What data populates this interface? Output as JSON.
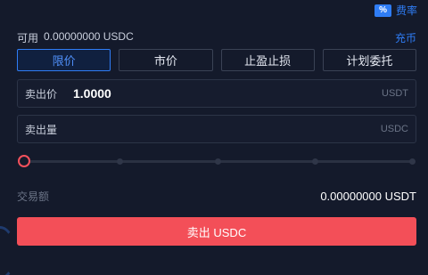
{
  "fee": {
    "badge": "%",
    "label": "费率"
  },
  "balance": {
    "label": "可用",
    "value": "0.00000000 USDC",
    "recharge": "充币"
  },
  "tabs": [
    {
      "label": "限价",
      "active": true
    },
    {
      "label": "市价",
      "active": false
    },
    {
      "label": "止盈止损",
      "active": false
    },
    {
      "label": "计划委托",
      "active": false
    }
  ],
  "price_field": {
    "label": "卖出价",
    "value": "1.0000",
    "unit": "USDT"
  },
  "amount_field": {
    "label": "卖出量",
    "value": "",
    "unit": "USDC"
  },
  "slider": {
    "percent": 0,
    "marks": [
      0,
      25,
      50,
      75,
      100
    ]
  },
  "total": {
    "label": "交易额",
    "value": "0.00000000 USDT"
  },
  "submit": {
    "label": "卖出 USDC"
  },
  "colors": {
    "accent": "#2f7df6",
    "sell": "#f34f58",
    "background": "#141a2b"
  }
}
